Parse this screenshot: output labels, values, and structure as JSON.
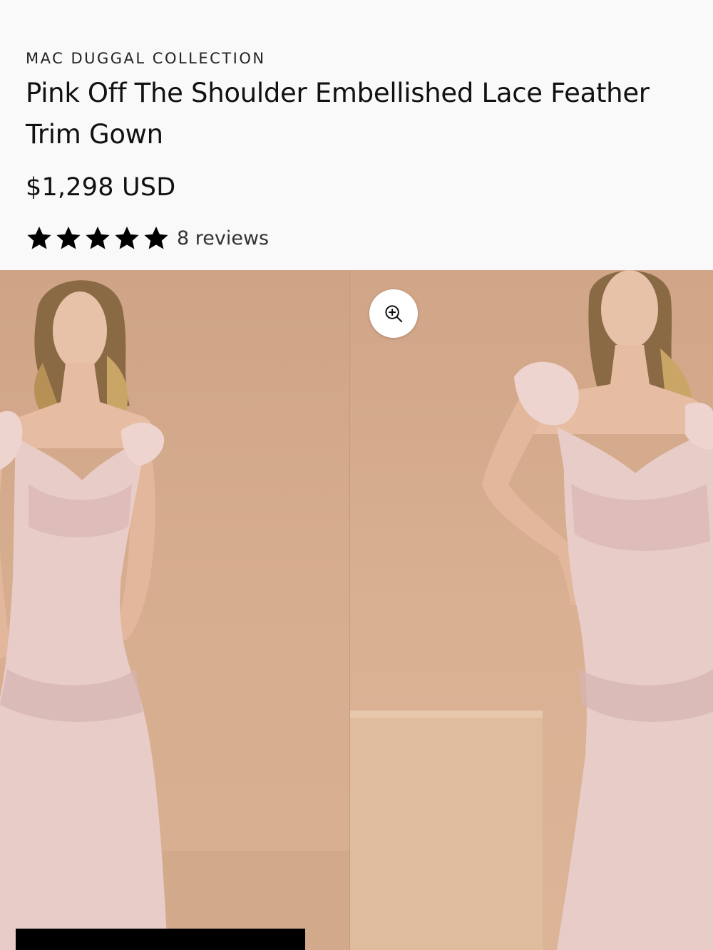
{
  "product": {
    "brand": "MAC DUGGAL COLLECTION",
    "title": "Pink Off The Shoulder Embellished Lace Feather Trim Gown",
    "price": "$1,298 USD",
    "rating": {
      "stars": 5,
      "max_stars": 5,
      "reviews_label": "8 reviews"
    }
  },
  "gallery": {
    "images": [
      {
        "alt": "Model front view in pink feather trim mermaid gown"
      },
      {
        "alt": "Model posed with hand on hip in pink feather trim mermaid gown"
      }
    ],
    "zoom_icon": "zoom-in-icon"
  },
  "colors": {
    "background": "#f9f9f9",
    "text": "#111111",
    "photo_backdrop": "#d7ad8f",
    "gown": "#e6c9c4",
    "bar": "#000000"
  }
}
